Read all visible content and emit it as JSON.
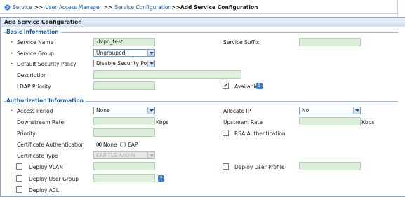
{
  "breadcrumb": {
    "items": [
      "Service",
      "User Access Manager",
      "Service Configuration"
    ],
    "separator": ">>",
    "current": "Add Service Configuration"
  },
  "panel": {
    "title": "Add Service Configuration"
  },
  "basic": {
    "title": "Basic Information",
    "service_name": {
      "label": "Service Name",
      "value": "dvpn_test"
    },
    "service_suffix": {
      "label": "Service Suffix",
      "value": ""
    },
    "service_group": {
      "label": "Service Group",
      "value": "Ungrouped"
    },
    "default_security_policy": {
      "label": "Default Security Policy",
      "value": "Disable Security Polic"
    },
    "description": {
      "label": "Description",
      "value": ""
    },
    "ldap_priority": {
      "label": "LDAP Priority",
      "value": ""
    },
    "available": {
      "label": "Available",
      "checked": true
    }
  },
  "authz": {
    "title": "Authorization Information",
    "access_period": {
      "label": "Access Period",
      "value": "None"
    },
    "allocate_ip": {
      "label": "Allocate IP",
      "value": "No"
    },
    "downstream_rate": {
      "label": "Downstream Rate",
      "value": "",
      "unit": "Kbps"
    },
    "upstream_rate": {
      "label": "Upstream Rate",
      "value": "",
      "unit": "Kbps"
    },
    "priority": {
      "label": "Priority",
      "value": ""
    },
    "rsa_authentication": {
      "label": "RSA Authentication",
      "checked": false
    },
    "certificate_authentication": {
      "label": "Certificate Authentication",
      "options": [
        "None",
        "EAP"
      ],
      "selected": "None"
    },
    "certificate_type": {
      "label": "Certificate Type",
      "value": "EAP-TLS AuthN"
    },
    "deploy_vlan": {
      "label": "Deploy VLAN",
      "checked": false,
      "value": ""
    },
    "deploy_user_profile": {
      "label": "Deploy User Profile",
      "checked": false,
      "value": ""
    },
    "deploy_user_group": {
      "label": "Deploy User Group",
      "checked": false,
      "value": ""
    },
    "deploy_acl": {
      "label": "Deploy ACL",
      "checked": false
    }
  },
  "icons": {
    "help": "?",
    "checkmark": "✔"
  },
  "colors": {
    "link": "#1d5fa8",
    "field_bg": "#dbefdb",
    "required": "#cc2222",
    "help": "#3a7cd0"
  }
}
